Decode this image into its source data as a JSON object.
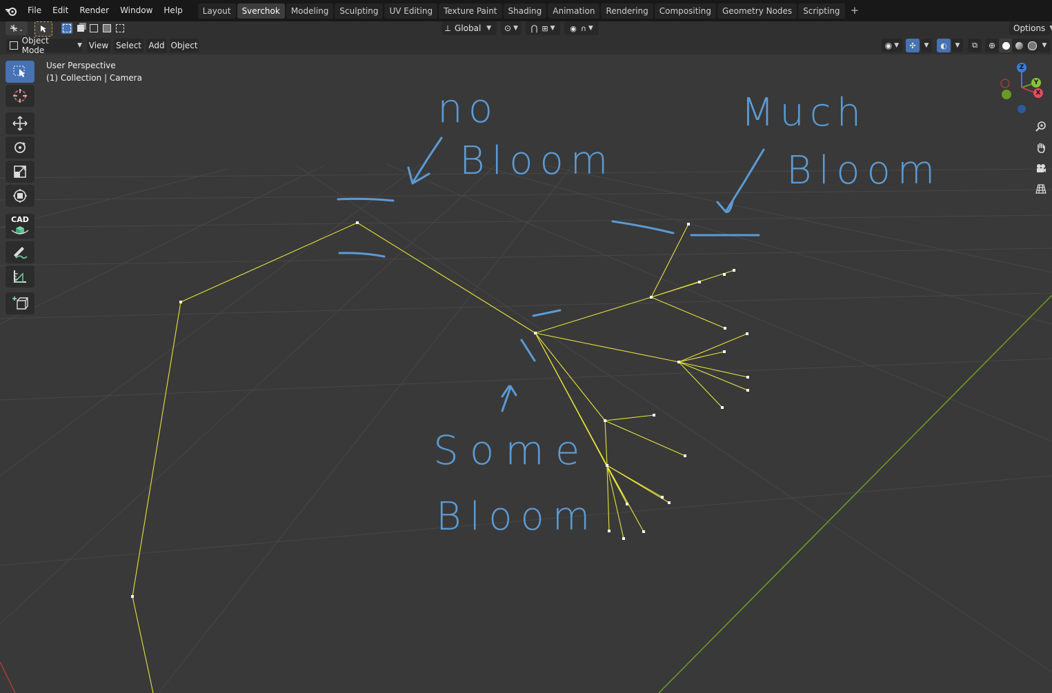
{
  "menu": [
    "File",
    "Edit",
    "Render",
    "Window",
    "Help"
  ],
  "workspace_tabs": [
    "Layout",
    "Sverchok",
    "Modeling",
    "Sculpting",
    "UV Editing",
    "Texture Paint",
    "Shading",
    "Animation",
    "Rendering",
    "Compositing",
    "Geometry Nodes",
    "Scripting"
  ],
  "active_tab": "Sverchok",
  "toolbar": {
    "orientation": "Global",
    "options": "Options"
  },
  "header": {
    "mode": "Object Mode",
    "menus": [
      "View",
      "Select",
      "Add",
      "Object"
    ]
  },
  "viewport": {
    "view_name": "User Perspective",
    "collection_info": "(1) Collection | Camera",
    "gizmo_axes": [
      "Z",
      "Y",
      "X"
    ]
  },
  "toolshelf": {
    "cad_label": "CAD"
  },
  "annotations": {
    "no_bloom": [
      "no",
      "Bloom"
    ],
    "much_bloom": [
      "Much",
      "Bloom"
    ],
    "some_bloom": [
      "Some",
      "Bloom"
    ]
  },
  "colors": {
    "accent": "#4772b3",
    "wire": "#e8e33a",
    "annotation": "#5b9bd5",
    "axis_y": "#6a9a23",
    "axis_x": "#a33b3b"
  }
}
